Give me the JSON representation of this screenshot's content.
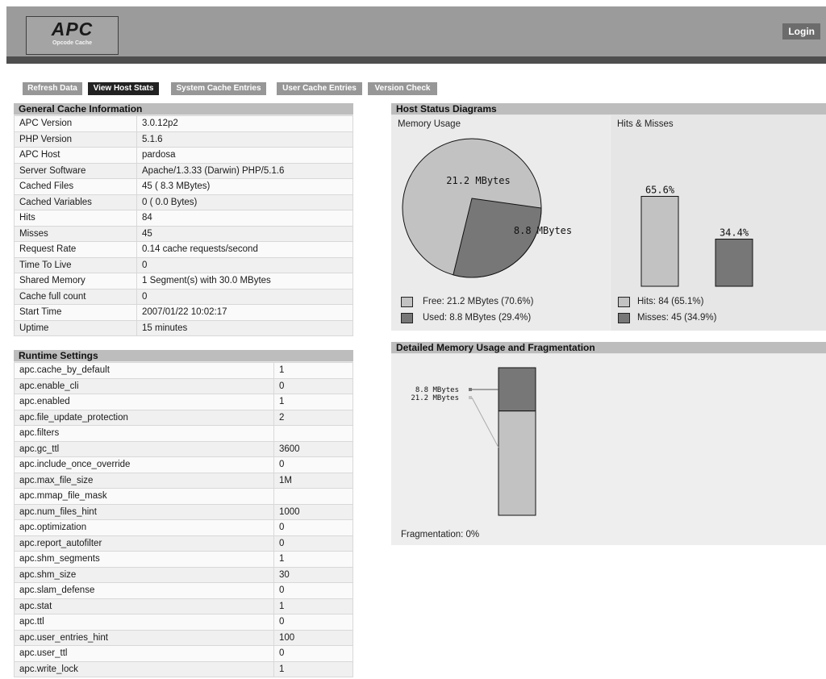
{
  "header": {
    "logo_title": "APC",
    "logo_subtitle": "Opcode Cache",
    "login_label": "Login"
  },
  "nav": [
    {
      "label": "Refresh Data",
      "active": false
    },
    {
      "label": "View Host Stats",
      "active": true
    },
    {
      "label": "System Cache Entries",
      "active": false
    },
    {
      "label": "User Cache Entries",
      "active": false
    },
    {
      "label": "Version Check",
      "active": false
    }
  ],
  "general": {
    "title": "General Cache Information",
    "rows": [
      {
        "label": "APC Version",
        "value": "3.0.12p2"
      },
      {
        "label": "PHP Version",
        "value": "5.1.6"
      },
      {
        "label": "APC Host",
        "value": "pardosa"
      },
      {
        "label": "Server Software",
        "value": "Apache/1.3.33 (Darwin) PHP/5.1.6"
      },
      {
        "label": "Cached Files",
        "value": "45 ( 8.3 MBytes)"
      },
      {
        "label": "Cached Variables",
        "value": "0 ( 0.0 Bytes)"
      },
      {
        "label": "Hits",
        "value": "84"
      },
      {
        "label": "Misses",
        "value": "45"
      },
      {
        "label": "Request Rate",
        "value": "0.14 cache requests/second"
      },
      {
        "label": "Time To Live",
        "value": "0"
      },
      {
        "label": "Shared Memory",
        "value": "1 Segment(s) with 30.0 MBytes"
      },
      {
        "label": "Cache full count",
        "value": "0"
      },
      {
        "label": "Start Time",
        "value": "2007/01/22 10:02:17"
      },
      {
        "label": "Uptime",
        "value": "15 minutes"
      }
    ]
  },
  "runtime": {
    "title": "Runtime Settings",
    "rows": [
      {
        "label": "apc.cache_by_default",
        "value": "1"
      },
      {
        "label": "apc.enable_cli",
        "value": "0"
      },
      {
        "label": "apc.enabled",
        "value": "1"
      },
      {
        "label": "apc.file_update_protection",
        "value": "2"
      },
      {
        "label": "apc.filters",
        "value": ""
      },
      {
        "label": "apc.gc_ttl",
        "value": "3600"
      },
      {
        "label": "apc.include_once_override",
        "value": "0"
      },
      {
        "label": "apc.max_file_size",
        "value": "1M"
      },
      {
        "label": "apc.mmap_file_mask",
        "value": ""
      },
      {
        "label": "apc.num_files_hint",
        "value": "1000"
      },
      {
        "label": "apc.optimization",
        "value": "0"
      },
      {
        "label": "apc.report_autofilter",
        "value": "0"
      },
      {
        "label": "apc.shm_segments",
        "value": "1"
      },
      {
        "label": "apc.shm_size",
        "value": "30"
      },
      {
        "label": "apc.slam_defense",
        "value": "0"
      },
      {
        "label": "apc.stat",
        "value": "1"
      },
      {
        "label": "apc.ttl",
        "value": "0"
      },
      {
        "label": "apc.user_entries_hint",
        "value": "100"
      },
      {
        "label": "apc.user_ttl",
        "value": "0"
      },
      {
        "label": "apc.write_lock",
        "value": "1"
      }
    ]
  },
  "host_status": {
    "title": "Host Status Diagrams",
    "memory_label": "Memory Usage",
    "hits_label": "Hits & Misses",
    "legend_free": "Free: 21.2 MBytes (70.6%)",
    "legend_used": "Used: 8.8 MBytes (29.4%)",
    "legend_hits": "Hits: 84 (65.1%)",
    "legend_misses": "Misses: 45 (34.9%)"
  },
  "fragmentation": {
    "title": "Detailed Memory Usage and Fragmentation",
    "label_used": "8.8 MBytes",
    "label_free": "21.2 MBytes",
    "fragmentation_text": "Fragmentation: 0%"
  },
  "colors": {
    "free": "#c2c2c2",
    "used": "#777777",
    "outline": "#111111"
  },
  "chart_data": [
    {
      "type": "pie",
      "title": "Memory Usage",
      "slices": [
        {
          "label": "21.2 MBytes",
          "value": 21.2
        },
        {
          "label": "8.8 MBytes",
          "value": 8.8
        }
      ]
    },
    {
      "type": "bar",
      "title": "Hits & Misses",
      "categories": [
        "Hits",
        "Misses"
      ],
      "values": [
        65.6,
        34.4
      ],
      "labels": [
        "65.6%",
        "34.4%"
      ]
    },
    {
      "type": "bar",
      "title": "Detailed Memory Usage and Fragmentation",
      "categories": [
        "8.8 MBytes",
        "21.2 MBytes"
      ],
      "values": [
        8.8,
        21.2
      ]
    }
  ]
}
